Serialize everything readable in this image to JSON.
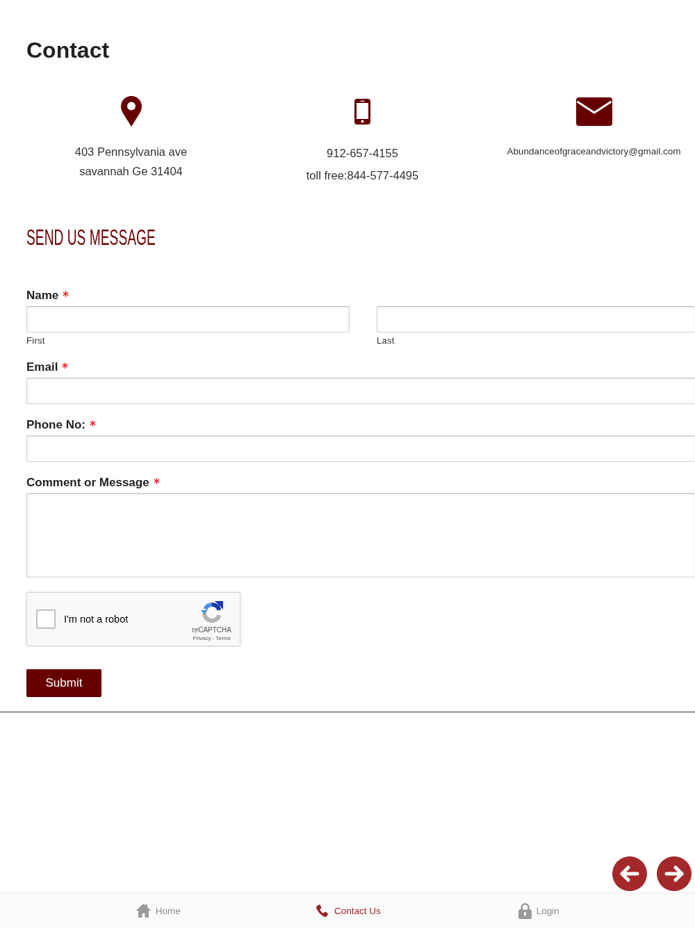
{
  "page": {
    "title": "Contact"
  },
  "contact_info": [
    {
      "kind": "address",
      "lines": [
        "403 Pennsylvania ave",
        "savannah Ge 31404"
      ]
    },
    {
      "kind": "phone",
      "lines": [
        "912-657-4155",
        "toll free:844-577-4495"
      ]
    },
    {
      "kind": "email",
      "lines": [
        "Abundanceofgraceandvictory@gmail.com"
      ]
    }
  ],
  "form": {
    "title": "SEND US MESSAGE",
    "fields": [
      {
        "kind": "name",
        "label": "Name",
        "required": true,
        "parts": [
          {
            "sublabel": "First"
          },
          {
            "sublabel": "Last"
          }
        ]
      },
      {
        "kind": "text",
        "label": "Email",
        "required": true
      },
      {
        "kind": "text",
        "label": "Phone No:",
        "required": true
      },
      {
        "kind": "textarea",
        "label": "Comment or Message",
        "required": true
      }
    ],
    "captcha": {
      "label": "I'm not a robot",
      "checked": false,
      "brand": "reCAPTCHA",
      "links": [
        "Privacy",
        "Terms"
      ],
      "separator": "-"
    },
    "submit": "Submit"
  },
  "bottom_nav": [
    {
      "label": "Home",
      "selected": false
    },
    {
      "label": "Contact Us",
      "selected": true
    },
    {
      "label": "Login",
      "selected": false
    }
  ]
}
